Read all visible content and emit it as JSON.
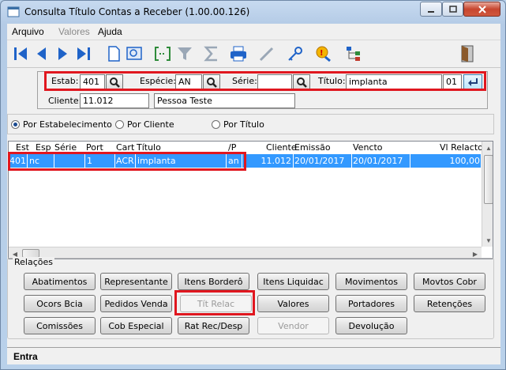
{
  "window": {
    "title": "Consulta Título Contas a Receber (1.00.00.126)"
  },
  "menu": {
    "arquivo": "Arquivo",
    "valores": "Valores",
    "ajuda": "Ajuda"
  },
  "toolbar": {
    "icons": [
      "first-icon",
      "previous-icon",
      "next-icon",
      "last-icon",
      "new-doc-icon",
      "preview-icon",
      "goto-icon",
      "filter-icon",
      "sum-icon",
      "print-icon",
      "pencil-icon",
      "key-icon",
      "search-alert-icon",
      "tree-icon",
      "exit-door-icon"
    ]
  },
  "header": {
    "estab_label": "Estab:",
    "estab_value": "401",
    "especie_label": "Espécie:",
    "especie_value": "AN",
    "serie_label": "Série:",
    "serie_value": "",
    "titulo_label": "Título:",
    "titulo_value": "implanta",
    "parcela_value": "01",
    "cliente_label": "Cliente:",
    "cliente_code": "11.012",
    "cliente_name": "Pessoa Teste"
  },
  "options": {
    "por_estabelecimento": "Por Estabelecimento",
    "por_cliente": "Por Cliente",
    "por_titulo": "Por Título",
    "selected": "por_estabelecimento"
  },
  "grid": {
    "columns": [
      "Est",
      "Esp",
      "Série",
      "Port",
      "Cart",
      "Título",
      "/P",
      "Cliente",
      "Emissão",
      "Vencto",
      "Vl Relacto"
    ],
    "rows": [
      [
        "401",
        "nc",
        "",
        "1",
        "ACR",
        "implanta",
        "an",
        "11.012",
        "20/01/2017",
        "20/01/2017",
        "100,00"
      ]
    ]
  },
  "relacoes": {
    "title": "Relações",
    "buttons": [
      "Abatimentos",
      "Representante",
      "Itens Borderô",
      "Itens Liquidac",
      "Movimentos",
      "Movtos Cobr",
      "Ocors Bcia",
      "Pedidos Venda",
      "Tít Relac",
      "Valores",
      "Portadores",
      "Retenções",
      "Comissões",
      "Cob Especial",
      "Rat Rec/Desp",
      "Vendor",
      "Devolução"
    ]
  },
  "status": {
    "text": "Entra"
  },
  "colors": {
    "highlight_red": "#e0171f",
    "selection_blue": "#3399ff",
    "toolbar_blue": "#1f63c8"
  }
}
